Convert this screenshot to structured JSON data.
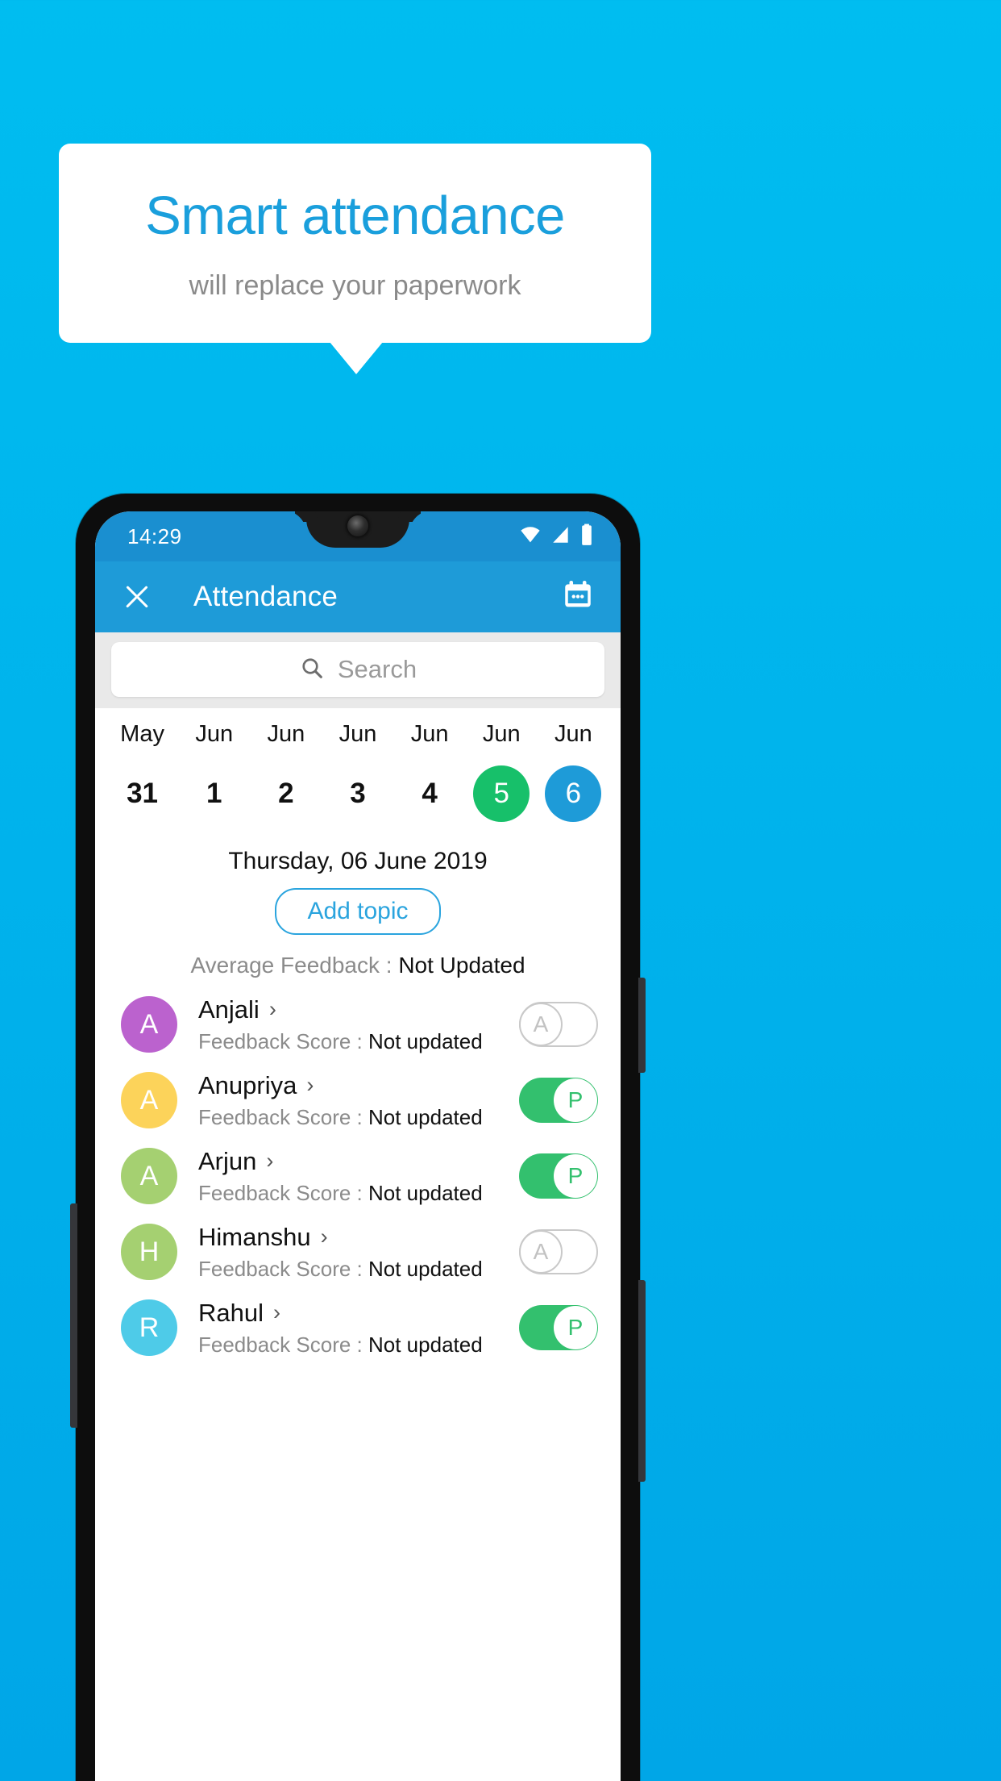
{
  "promo": {
    "title": "Smart attendance",
    "subtitle": "will replace your paperwork",
    "title_color": "#1a9fdc",
    "subtitle_color": "#8a8a8a"
  },
  "phone": {
    "statusbar": {
      "time": "14:29",
      "icons": [
        "wifi-icon",
        "signal-icon",
        "battery-icon"
      ]
    },
    "appbar": {
      "close_icon": "close-icon",
      "title": "Attendance",
      "calendar_icon": "calendar-icon",
      "background": "#1e9bd8"
    },
    "search": {
      "icon": "search-icon",
      "placeholder": "Search"
    },
    "dates": [
      {
        "month": "May",
        "day": "31",
        "state": "normal"
      },
      {
        "month": "Jun",
        "day": "1",
        "state": "normal"
      },
      {
        "month": "Jun",
        "day": "2",
        "state": "normal"
      },
      {
        "month": "Jun",
        "day": "3",
        "state": "normal"
      },
      {
        "month": "Jun",
        "day": "4",
        "state": "normal"
      },
      {
        "month": "Jun",
        "day": "5",
        "state": "today"
      },
      {
        "month": "Jun",
        "day": "6",
        "state": "selected"
      }
    ],
    "selected_date_label": "Thursday, 06 June 2019",
    "add_topic_label": "Add topic",
    "average_feedback": {
      "label": "Average Feedback : ",
      "value": "Not Updated"
    },
    "score_label": "Feedback Score : ",
    "students": [
      {
        "name": "Anjali",
        "initial": "A",
        "avatar_color": "#bb62ce",
        "score": "Not updated",
        "attendance": "A",
        "present": false
      },
      {
        "name": "Anupriya",
        "initial": "A",
        "avatar_color": "#fcd35a",
        "score": "Not updated",
        "attendance": "P",
        "present": true
      },
      {
        "name": "Arjun",
        "initial": "A",
        "avatar_color": "#a5d071",
        "score": "Not updated",
        "attendance": "P",
        "present": true
      },
      {
        "name": "Himanshu",
        "initial": "H",
        "avatar_color": "#a5d071",
        "score": "Not updated",
        "attendance": "A",
        "present": false
      },
      {
        "name": "Rahul",
        "initial": "R",
        "avatar_color": "#4ecbe8",
        "score": "Not updated",
        "attendance": "P",
        "present": true
      }
    ],
    "colors": {
      "today_green": "#17c06a",
      "selected_blue": "#1e9bd8",
      "present_green": "#33c06e",
      "absent_gray": "#c9c9c9"
    }
  }
}
